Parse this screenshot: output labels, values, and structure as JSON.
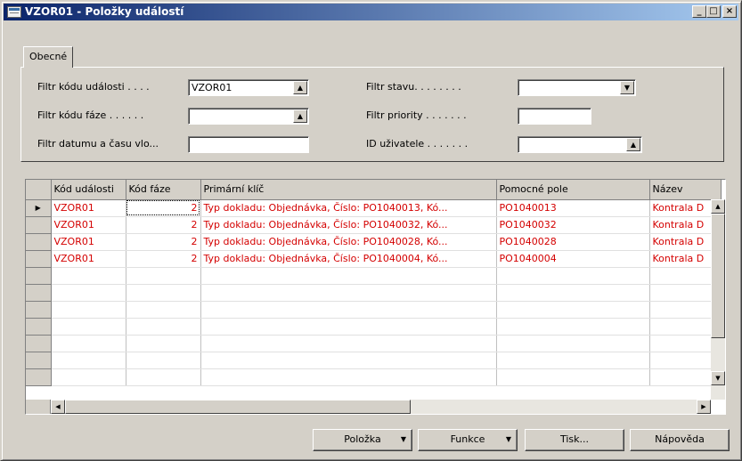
{
  "window": {
    "title": "VZOR01 - Položky událostí",
    "minimize": "_",
    "maximize": "□",
    "close": "×"
  },
  "tabs": [
    {
      "label": "Obecné"
    }
  ],
  "filters": {
    "event_code": {
      "label": "Filtr kódu události . . . .",
      "value": "VZOR01"
    },
    "phase_code": {
      "label": "Filtr kódu fáze . . . . . .",
      "value": ""
    },
    "datetime": {
      "label": "Filtr datumu a času vlo...",
      "value": ""
    },
    "status": {
      "label": "Filtr stavu. . . . . . . .",
      "value": ""
    },
    "priority": {
      "label": "Filtr priority . . . . . . .",
      "value": ""
    },
    "user_id": {
      "label": "ID uživatele . . . . . . .",
      "value": ""
    }
  },
  "table": {
    "columns": [
      "Kód události",
      "Kód fáze",
      "Primární klíč",
      "Pomocné pole",
      "Název"
    ],
    "rows": [
      [
        "VZOR01",
        "2",
        "Typ dokladu: Objednávka, Číslo: PO1040013, Kó...",
        "PO1040013",
        "Kontrala D"
      ],
      [
        "VZOR01",
        "2",
        "Typ dokladu: Objednávka, Číslo: PO1040032, Kó...",
        "PO1040032",
        "Kontrala D"
      ],
      [
        "VZOR01",
        "2",
        "Typ dokladu: Objednávka, Číslo: PO1040028, Kó...",
        "PO1040028",
        "Kontrala D"
      ],
      [
        "VZOR01",
        "2",
        "Typ dokladu: Objednávka, Číslo: PO1040004, Kó...",
        "PO1040004",
        "Kontrala D"
      ]
    ],
    "current_row_marker": "▶"
  },
  "buttons": {
    "item": "Položka",
    "functions": "Funkce",
    "print": "Tisk...",
    "help": "Nápověda"
  },
  "icons": {
    "lookup": "up-arrow-lookup-icon",
    "dropdown": "chevron-down-icon"
  },
  "colors": {
    "title_start": "#0a246a",
    "title_end": "#a6caf0",
    "row_text": "#d40000",
    "face": "#d4d0c8"
  }
}
